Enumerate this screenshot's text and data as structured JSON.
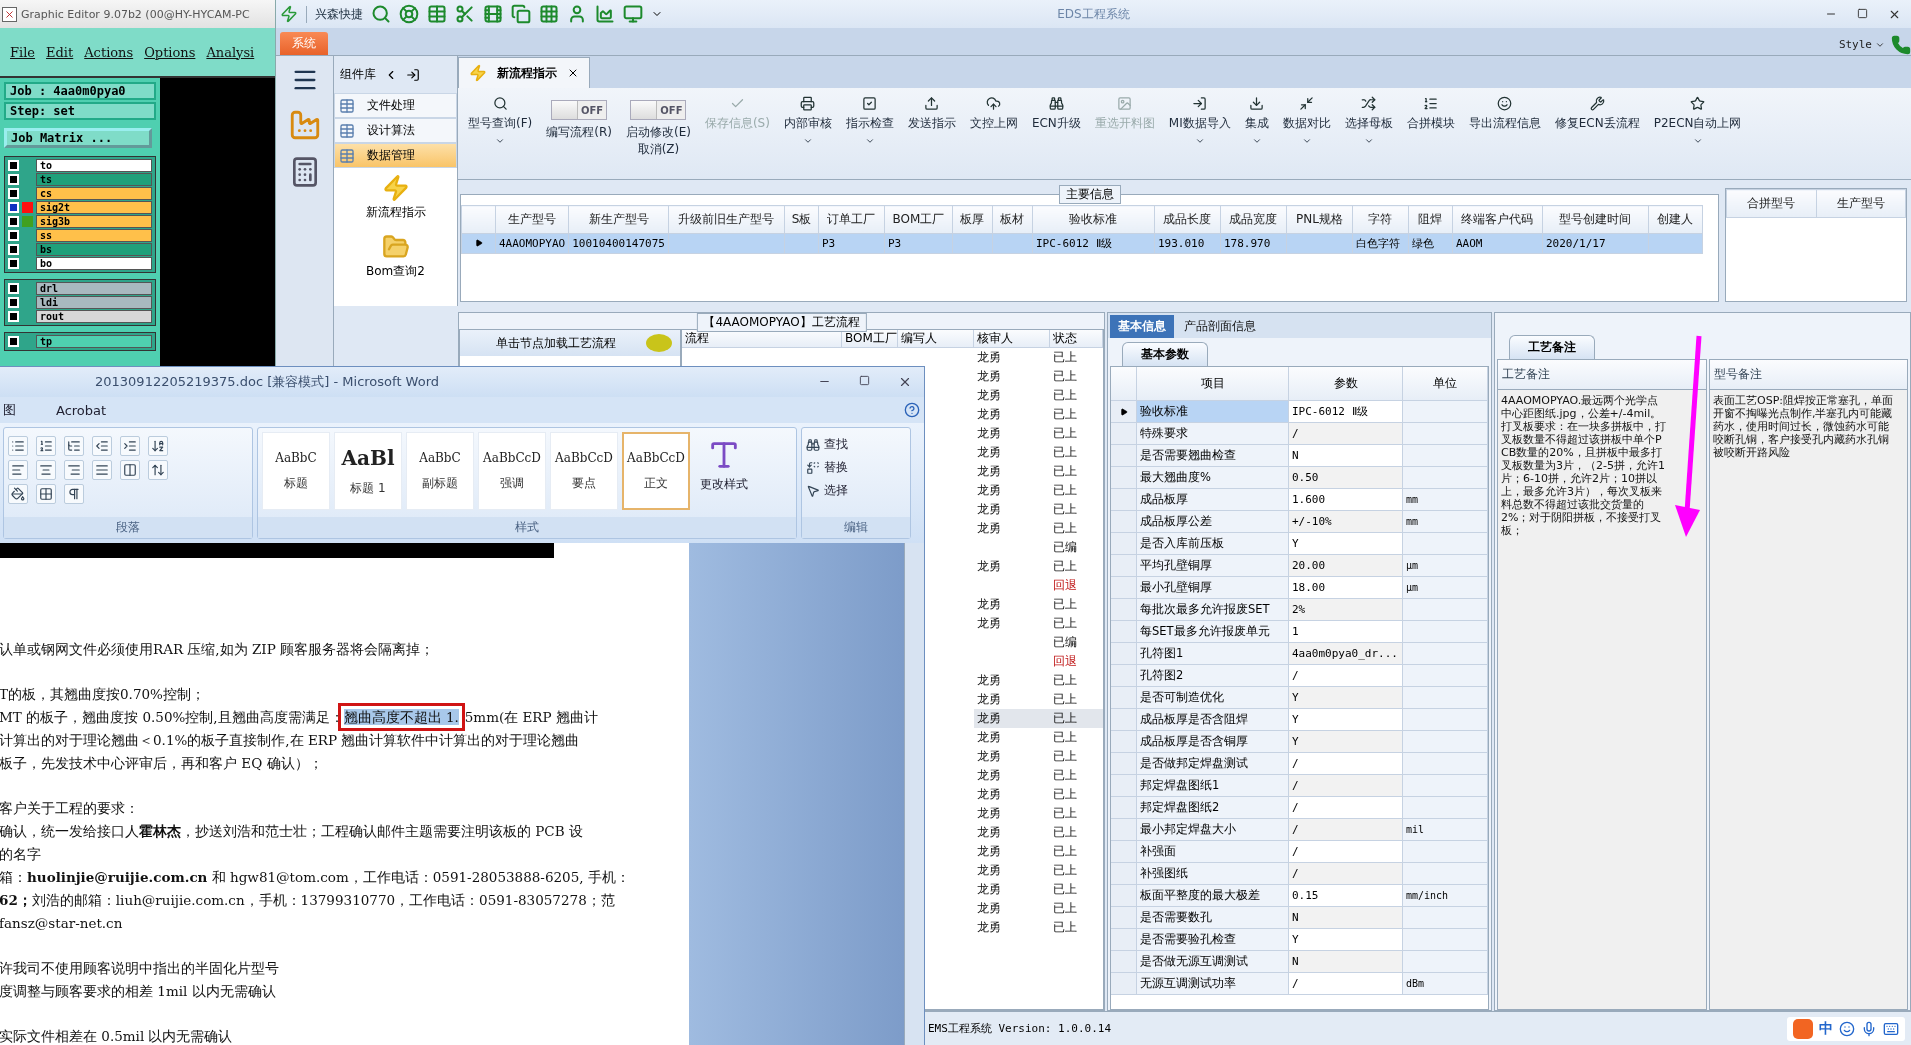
{
  "graphic_editor": {
    "title": "Graphic Editor 9.07b2 (00@HY-HYCAM-PC",
    "menu": [
      "File",
      "Edit",
      "Actions",
      "Options",
      "Analysi"
    ],
    "job": "Job : 4aa0m0pya0",
    "step": "Step: set",
    "job_matrix": "Job Matrix ...",
    "layer_groups": [
      [
        {
          "name": "to",
          "color": "#ffffff",
          "selected": false
        },
        {
          "name": "ts",
          "color": "#1fa07a",
          "selected": false
        },
        {
          "name": "cs",
          "color": "#ffc04a",
          "selected": false
        },
        {
          "name": "sig2t",
          "color": "#ffc04a",
          "selected": true,
          "marker": {
            "color": "#ff1010"
          }
        },
        {
          "name": "sig3b",
          "color": "#ffc04a",
          "selected": false,
          "marker": {
            "color": "#40a020"
          }
        },
        {
          "name": "ss",
          "color": "#ffc04a",
          "selected": false
        },
        {
          "name": "bs",
          "color": "#1fa07a",
          "selected": false
        },
        {
          "name": "bo",
          "color": "#ffffff",
          "selected": false
        }
      ],
      [
        {
          "name": "drl",
          "color": "#a9b9bf",
          "selected": false
        },
        {
          "name": "ldi",
          "color": "#a9b9bf",
          "selected": false
        },
        {
          "name": "rout",
          "color": "#d8d8d8",
          "selected": false
        }
      ],
      [
        {
          "name": "tp",
          "color": "#4fd0b0",
          "selected": false
        }
      ]
    ]
  },
  "eds": {
    "quick_label": "兴森快捷",
    "title": "EDS工程系统",
    "system_tab": "系统",
    "style_menu": "Style",
    "component_library": {
      "title": "组件库",
      "groups": [
        {
          "label": "文件处理",
          "selected": false
        },
        {
          "label": "设计算法",
          "selected": false
        },
        {
          "label": "数据管理",
          "selected": true
        }
      ],
      "items": [
        "新流程指示",
        "Bom查询2"
      ]
    },
    "doc_tab": "新流程指示",
    "ribbon": [
      {
        "kind": "button",
        "label": "型号查询(F)",
        "disabled": false,
        "dropdown": true
      },
      {
        "kind": "toggle",
        "label": "编写流程(R)",
        "toggle_text": "OFF",
        "on": false
      },
      {
        "kind": "toggle",
        "label": "启动修改(E)",
        "label2": "取消(Z)",
        "toggle_text": "OFF",
        "on": false
      },
      {
        "kind": "button",
        "label": "保存信息(S)",
        "disabled": true,
        "dropdown": false
      },
      {
        "kind": "button",
        "label": "内部审核",
        "disabled": false,
        "dropdown": true
      },
      {
        "kind": "button",
        "label": "指示检查",
        "disabled": false,
        "dropdown": true
      },
      {
        "kind": "button",
        "label": "发送指示",
        "disabled": false,
        "dropdown": false
      },
      {
        "kind": "button",
        "label": "文控上网",
        "disabled": false,
        "dropdown": false
      },
      {
        "kind": "button",
        "label": "ECN升级",
        "disabled": false,
        "dropdown": false
      },
      {
        "kind": "button",
        "label": "重选开料图",
        "disabled": true,
        "dropdown": false
      },
      {
        "kind": "button",
        "label": "MI数据导入",
        "disabled": false,
        "dropdown": true
      },
      {
        "kind": "button",
        "label": "集成",
        "disabled": false,
        "dropdown": true
      },
      {
        "kind": "button",
        "label": "数据对比",
        "disabled": false,
        "dropdown": true
      },
      {
        "kind": "button",
        "label": "选择母板",
        "disabled": false,
        "dropdown": true
      },
      {
        "kind": "button",
        "label": "合拼模块",
        "disabled": false,
        "dropdown": false
      },
      {
        "kind": "button",
        "label": "导出流程信息",
        "disabled": false,
        "dropdown": false
      },
      {
        "kind": "button",
        "label": "修复ECN丢流程",
        "disabled": false,
        "dropdown": false
      },
      {
        "kind": "button",
        "label": "P2ECN自动上网",
        "disabled": false,
        "dropdown": true
      }
    ],
    "main_info": {
      "legend": "主要信息",
      "columns": [
        "生产型号",
        "新生产型号",
        "升级前旧生产型号",
        "S板",
        "订单工厂",
        "BOM工厂",
        "板厚",
        "板材",
        "验收标准",
        "成品长度",
        "成品宽度",
        "PNL规格",
        "字符",
        "阻焊",
        "终端客户代码",
        "型号创建时间",
        "创建人"
      ],
      "rows": [
        {
          "selected": true,
          "cells": [
            "4AAOMOPYAO",
            "10010400147075",
            "",
            "",
            "P3",
            "P3",
            "",
            "",
            "IPC-6012 Ⅱ级",
            "193.010",
            "178.970",
            "",
            "白色字符",
            "绿色",
            "AAOM",
            "2020/1/17",
            ""
          ]
        }
      ],
      "merge_columns": [
        "合拼型号",
        "生产型号"
      ]
    },
    "process": {
      "legend": "【4AAOMOPYAO】工艺流程",
      "hint": "单击节点加载工艺流程",
      "columns": [
        "流程",
        "BOM工厂",
        "编写人",
        "核审人",
        "状态"
      ],
      "rows": [
        {
          "reviewer": "龙勇",
          "status": "已上",
          "returned": false,
          "selected": false
        },
        {
          "reviewer": "龙勇",
          "status": "已上",
          "returned": false,
          "selected": false
        },
        {
          "reviewer": "龙勇",
          "status": "已上",
          "returned": false,
          "selected": false
        },
        {
          "reviewer": "龙勇",
          "status": "已上",
          "returned": false,
          "selected": false
        },
        {
          "reviewer": "龙勇",
          "status": "已上",
          "returned": false,
          "selected": false
        },
        {
          "reviewer": "龙勇",
          "status": "已上",
          "returned": false,
          "selected": false
        },
        {
          "reviewer": "龙勇",
          "status": "已上",
          "returned": false,
          "selected": false
        },
        {
          "reviewer": "龙勇",
          "status": "已上",
          "returned": false,
          "selected": false
        },
        {
          "reviewer": "龙勇",
          "status": "已上",
          "returned": false,
          "selected": false
        },
        {
          "reviewer": "龙勇",
          "status": "已上",
          "returned": false,
          "selected": false
        },
        {
          "reviewer": "",
          "status": "已编",
          "returned": false,
          "selected": false
        },
        {
          "reviewer": "龙勇",
          "status": "已上",
          "returned": false,
          "selected": false
        },
        {
          "reviewer": "",
          "status": "回退",
          "returned": true,
          "selected": false
        },
        {
          "reviewer": "龙勇",
          "status": "已上",
          "returned": false,
          "selected": false
        },
        {
          "reviewer": "龙勇",
          "status": "已上",
          "returned": false,
          "selected": false
        },
        {
          "reviewer": "",
          "status": "已编",
          "returned": false,
          "selected": false
        },
        {
          "reviewer": "",
          "status": "回退",
          "returned": true,
          "selected": false
        },
        {
          "reviewer": "龙勇",
          "status": "已上",
          "returned": false,
          "selected": false
        },
        {
          "reviewer": "龙勇",
          "status": "已上",
          "returned": false,
          "selected": false
        },
        {
          "reviewer": "龙勇",
          "status": "已上",
          "returned": false,
          "selected": true
        },
        {
          "reviewer": "龙勇",
          "status": "已上",
          "returned": false,
          "selected": false
        },
        {
          "reviewer": "龙勇",
          "status": "已上",
          "returned": false,
          "selected": false
        },
        {
          "reviewer": "龙勇",
          "status": "已上",
          "returned": false,
          "selected": false
        },
        {
          "reviewer": "龙勇",
          "status": "已上",
          "returned": false,
          "selected": false
        },
        {
          "reviewer": "龙勇",
          "status": "已上",
          "returned": false,
          "selected": false
        },
        {
          "reviewer": "龙勇",
          "status": "已上",
          "returned": false,
          "selected": false
        },
        {
          "reviewer": "龙勇",
          "status": "已上",
          "returned": false,
          "selected": false
        },
        {
          "reviewer": "龙勇",
          "status": "已上",
          "returned": false,
          "selected": false
        },
        {
          "reviewer": "龙勇",
          "status": "已上",
          "returned": false,
          "selected": false
        },
        {
          "reviewer": "龙勇",
          "status": "已上",
          "returned": false,
          "selected": false
        },
        {
          "reviewer": "龙勇",
          "status": "已上",
          "returned": false,
          "selected": false
        }
      ]
    },
    "basic_info": {
      "tabs": [
        {
          "label": "基本信息",
          "selected": true
        },
        {
          "label": "产品剖面信息",
          "selected": false
        }
      ],
      "subtab": "基本参数",
      "columns": [
        "项目",
        "参数",
        "单位"
      ],
      "rows": [
        {
          "item": "验收标准",
          "value": "IPC-6012 Ⅱ级",
          "unit": "",
          "selected": true
        },
        {
          "item": "特殊要求",
          "value": "/",
          "unit": "",
          "selected": false
        },
        {
          "item": "是否需要翘曲检查",
          "value": "N",
          "unit": "",
          "selected": false
        },
        {
          "item": "最大翘曲度%",
          "value": "0.50",
          "unit": "",
          "selected": false
        },
        {
          "item": "成品板厚",
          "value": "1.600",
          "unit": "mm",
          "selected": false
        },
        {
          "item": "成品板厚公差",
          "value": "+/-10%",
          "unit": "mm",
          "selected": false
        },
        {
          "item": "是否入库前压板",
          "value": "Y",
          "unit": "",
          "selected": false
        },
        {
          "item": "平均孔壁铜厚",
          "value": "20.00",
          "unit": "μm",
          "selected": false
        },
        {
          "item": "最小孔壁铜厚",
          "value": "18.00",
          "unit": "μm",
          "selected": false
        },
        {
          "item": "每批次最多允许报废SET",
          "value": "2%",
          "unit": "",
          "selected": false
        },
        {
          "item": "每SET最多允许报废单元",
          "value": "1",
          "unit": "",
          "selected": false
        },
        {
          "item": "孔符图1",
          "value": "4aa0m0pya0_dr...",
          "unit": "",
          "selected": false
        },
        {
          "item": "孔符图2",
          "value": "/",
          "unit": "",
          "selected": false
        },
        {
          "item": "是否可制造优化",
          "value": "Y",
          "unit": "",
          "selected": false
        },
        {
          "item": "成品板厚是否含阻焊",
          "value": "Y",
          "unit": "",
          "selected": false
        },
        {
          "item": "成品板厚是否含铜厚",
          "value": "Y",
          "unit": "",
          "selected": false
        },
        {
          "item": "是否做邦定焊盘测试",
          "value": "/",
          "unit": "",
          "selected": false
        },
        {
          "item": "邦定焊盘图纸1",
          "value": "/",
          "unit": "",
          "selected": false
        },
        {
          "item": "邦定焊盘图纸2",
          "value": "/",
          "unit": "",
          "selected": false
        },
        {
          "item": "最小邦定焊盘大小",
          "value": "/",
          "unit": "mil",
          "selected": false
        },
        {
          "item": "补强面",
          "value": "/",
          "unit": "",
          "selected": false
        },
        {
          "item": "补强图纸",
          "value": "/",
          "unit": "",
          "selected": false
        },
        {
          "item": "板面平整度的最大极差",
          "value": "0.15",
          "unit": "mm/inch",
          "selected": false
        },
        {
          "item": "是否需要数孔",
          "value": "N",
          "unit": "",
          "selected": false
        },
        {
          "item": "是否需要验孔检查",
          "value": "Y",
          "unit": "",
          "selected": false
        },
        {
          "item": "是否做无源互调测试",
          "value": "N",
          "unit": "",
          "selected": false
        },
        {
          "item": "无源互调测试功率",
          "value": "/",
          "unit": "dBm",
          "selected": false
        }
      ]
    },
    "notes": {
      "tab": "工艺备注",
      "columns": [
        "工艺备注",
        "型号备注"
      ],
      "process_note": "4AAOMOPYAO.最远两个光学点中心距图纸.jpg，公差+/-4mil。打叉板要求：在一块多拼板中，打叉板数量不得超过该拼板中单个PCB数量的20%，且拼板中最多打叉板数量为3片，（2-5拼，允许1片；6-10拼，允许2片；10拼以上，最多允许3片），每次叉板来料总数不得超过该批交货量的2%；对于阴阳拼板，不接受打叉板；",
      "model_note": "表面工艺OSP:阻焊按正常塞孔，单面开窗不掏曝光点制作,半塞孔内可能藏药水，使用时间过长，微蚀药水可能咬断孔铜，客户接受孔内藏药水孔铜被咬断开路风险"
    },
    "status_bar": "EMS工程系统 Version: 1.0.0.14",
    "ime": "中"
  },
  "word": {
    "title": "20130912205219375.doc [兼容模式] - Microsoft Word",
    "ribbon_tabs": [
      "图",
      "Acrobat"
    ],
    "groups": [
      "段落",
      "样式",
      "编辑"
    ],
    "styles": [
      {
        "preview": "AaBbC",
        "label": "标题",
        "selected": false
      },
      {
        "preview": "AaBl",
        "label": "标题 1",
        "selected": false
      },
      {
        "preview": "AaBbC",
        "label": "副标题",
        "selected": false
      },
      {
        "preview": "AaBbCcD",
        "label": "强调",
        "selected": false
      },
      {
        "preview": "AaBbCcD",
        "label": "要点",
        "selected": false
      },
      {
        "preview": "AaBbCcD",
        "label": "正文",
        "selected": true
      }
    ],
    "change_styles": "更改样式",
    "edit_actions": [
      "查找",
      "替换",
      "选择"
    ],
    "lines": [
      {
        "gap": true,
        "parts": [
          {
            "text": "认单或钢网文件必须使用RAR 压缩,如为 ZIP 顾客服务器将会隔离掉；",
            "marked": false
          }
        ]
      },
      {
        "gap": true,
        "parts": [
          {
            "text": "T的板，其翘曲度按0.70%控制；",
            "marked": false
          }
        ]
      },
      {
        "gap": false,
        "parts": [
          {
            "text": "MT 的板子，翘曲度按 0.50%控制,且翘曲高度需满足：",
            "marked": false
          },
          {
            "text": "翘曲高度不超出 1.",
            "marked": true
          },
          {
            "text": "5mm(在 ERP 翘曲计",
            "marked": false
          }
        ]
      },
      {
        "gap": false,
        "parts": [
          {
            "text": "计算出的对于理论翘曲＜0.1%的板子直接制作,在 ERP 翘曲计算软件中计算出的对于理论翘曲",
            "marked": false
          }
        ]
      },
      {
        "gap": false,
        "parts": [
          {
            "text": "板子，先发技术中心评审后，再和客户 EQ 确认）；",
            "marked": false
          }
        ]
      },
      {
        "gap": true,
        "parts": [
          {
            "text": "客户关于工程的要求：",
            "marked": false
          }
        ]
      },
      {
        "gap": false,
        "parts": [
          {
            "text": "确认，统一发给接口人**霍林杰**，抄送刘浩和范士壮；工程确认邮件主题需要注明该板的 PCB 设",
            "marked": false
          }
        ]
      },
      {
        "gap": false,
        "parts": [
          {
            "text": "的名字",
            "marked": false
          }
        ]
      },
      {
        "gap": false,
        "parts": [
          {
            "text": "箱：**huolinjie@ruijie.com.cn** 和 hgw81@tom.com，工作电话：0591-28053888-6205, 手机：",
            "marked": false
          }
        ]
      },
      {
        "gap": false,
        "parts": [
          {
            "text": "**62；**刘浩的邮箱：liuh@ruijie.com.cn，手机：13799310770，工作电话：0591-83057278；范",
            "marked": false
          }
        ]
      },
      {
        "gap": false,
        "parts": [
          {
            "text": "fansz@star-net.cn",
            "marked": false
          }
        ]
      },
      {
        "gap": true,
        "parts": [
          {
            "text": "许我司不使用顾客说明中指出的半固化片型号",
            "marked": false
          }
        ]
      },
      {
        "gap": false,
        "parts": [
          {
            "text": "度调整与顾客要求的相差 1mil 以内无需确认",
            "marked": false
          }
        ]
      },
      {
        "gap": true,
        "parts": [
          {
            "text": "实际文件相差在 0.5mil 以内无需确认",
            "marked": false
          }
        ]
      }
    ]
  }
}
